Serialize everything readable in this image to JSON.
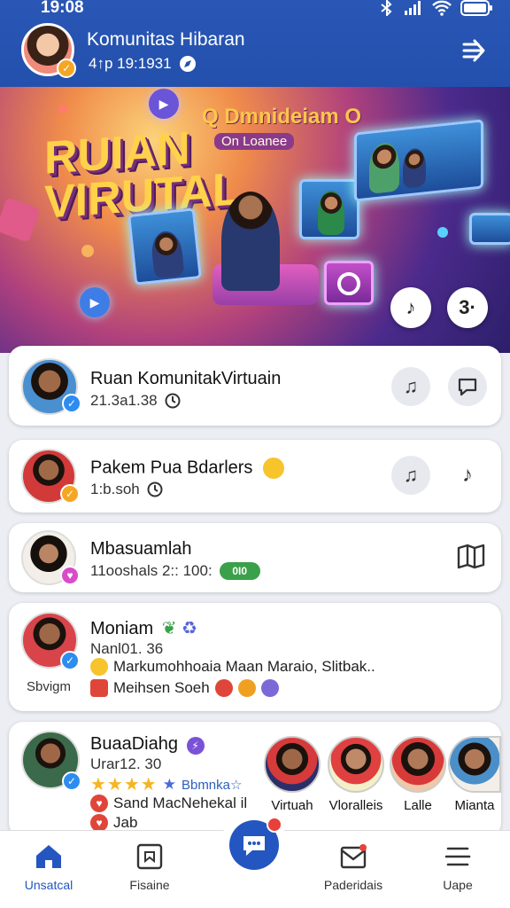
{
  "status": {
    "time": "19:08"
  },
  "header": {
    "title": "Komunitas Hibaran",
    "subtitle": "4↑p 19:1931",
    "exit_icon": "exit-icon"
  },
  "banner": {
    "title_line1": "RUIAN",
    "title_line2": "VIRUTAL",
    "subtitle": "Q Dmnideiam O",
    "tagline": "On Loanee",
    "fab_music_symbol": "♪",
    "fab_more_label": "3·"
  },
  "cards": [
    {
      "title": "Ruan KomunitakVirtuain",
      "sub": "21.3a1.38"
    },
    {
      "title": "Pakem Pua Bdarlers",
      "sub": "1:b.soh"
    },
    {
      "title": "Mbasuamlah",
      "sub": "11ooshals 2:: 100:",
      "sub_badge": "0I0"
    },
    {
      "title": "Moniam",
      "sub": "Nanl01. 36",
      "caption": "Sbvigm",
      "line1": "Markumohhoaia Maan Maraio, Slitbak..",
      "line2": "Meihsen Soeh"
    },
    {
      "title": "BuaaDiahg",
      "sub": "Urar12. 30",
      "stars_label": "Bbmnka☆",
      "line1": "Sand MacNehekal il",
      "line2": "Jab",
      "members": [
        {
          "name": "Virtuah"
        },
        {
          "name": "Vloralleis"
        },
        {
          "name": "Lalle"
        },
        {
          "name": "Mianta"
        }
      ]
    }
  ],
  "nav": {
    "items": [
      {
        "label": "Unsatcal"
      },
      {
        "label": "Fisaine"
      },
      {
        "label": "Paderidais"
      },
      {
        "label": "Uape"
      }
    ]
  },
  "colors": {
    "header": "#2350ad",
    "accent": "#2356c0",
    "badge_gold": "#f5a623",
    "badge_blue": "#2d8cf0"
  }
}
